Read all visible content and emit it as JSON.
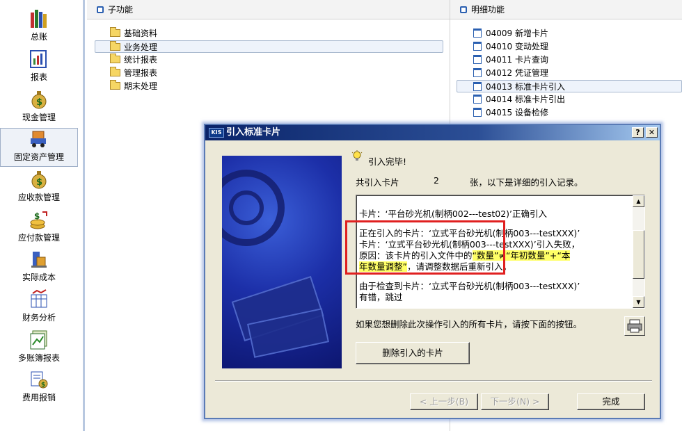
{
  "sidebar": {
    "items": [
      {
        "label": "总账",
        "icon": "ledger-books-icon"
      },
      {
        "label": "报表",
        "icon": "report-icon"
      },
      {
        "label": "现金管理",
        "icon": "cash-bag-icon"
      },
      {
        "label": "固定资产管理",
        "icon": "fixed-asset-truck-icon"
      },
      {
        "label": "应收款管理",
        "icon": "receivable-bag-icon"
      },
      {
        "label": "应付款管理",
        "icon": "payable-coins-icon"
      },
      {
        "label": "实际成本",
        "icon": "cost-icon"
      },
      {
        "label": "财务分析",
        "icon": "analysis-icon"
      },
      {
        "label": "多账簿报表",
        "icon": "multi-ledger-icon"
      },
      {
        "label": "费用报销",
        "icon": "expense-icon"
      }
    ]
  },
  "subfunc": {
    "header": "子功能",
    "items": [
      "基础资料",
      "业务处理",
      "统计报表",
      "管理报表",
      "期末处理"
    ]
  },
  "detail": {
    "header": "明细功能",
    "items": [
      {
        "code": "04009",
        "label": "新增卡片"
      },
      {
        "code": "04010",
        "label": "变动处理"
      },
      {
        "code": "04011",
        "label": "卡片查询"
      },
      {
        "code": "04012",
        "label": "凭证管理"
      },
      {
        "code": "04013",
        "label": "标准卡片引入"
      },
      {
        "code": "04014",
        "label": "标准卡片引出"
      },
      {
        "code": "04015",
        "label": "设备检修"
      }
    ]
  },
  "dialog": {
    "logo": "KIS",
    "title": "引入标准卡片",
    "help_btn": "?",
    "close_btn": "✕",
    "complete": "引入完毕!",
    "summary_prefix": "共引入卡片",
    "summary_count": "2",
    "summary_suffix": "张，以下是详细的引入记录。",
    "log": {
      "line1": "卡片：‘平台砂光机(制柄002---test02)’正确引入",
      "line2": "正在引入的卡片：‘立式平台砂光机(制柄003---testXXX)’",
      "line3": "卡片：‘立式平台砂光机(制柄003---testXXX)’引入失败，",
      "line4_pre": "原因：该卡片的引入文件中的",
      "line4_hl": "“数量”≠“年初数量”+“本",
      "line5_hl": "年数量调整”",
      "line5_post": "，请调整数据后重新引入。",
      "line6": "由于检查到卡片：‘立式平台砂光机(制柄003---testXXX)’",
      "line7": "有错，跳过"
    },
    "delete_hint": "如果您想删除此次操作引入的所有卡片，请按下面的按钮。",
    "delete_btn": "删除引入的卡片",
    "prev_btn": "< 上一步(B)",
    "next_btn": "下一步(N) >",
    "finish_btn": "完成"
  }
}
